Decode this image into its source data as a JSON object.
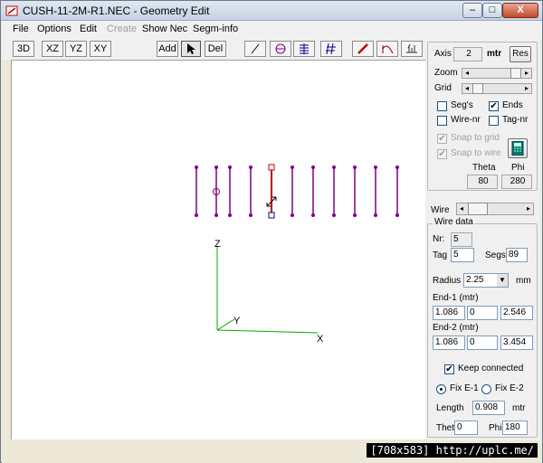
{
  "window": {
    "title": "CUSH-11-2M-R1.NEC - Geometry Edit",
    "min_label": "–",
    "max_label": "□",
    "close_label": "X"
  },
  "menu": [
    "File",
    "Options",
    "Edit",
    "Create",
    "Show Nec",
    "Segm-info"
  ],
  "toolbar": {
    "view_3d": "3D",
    "view_xz": "XZ",
    "view_yz": "YZ",
    "view_xy": "XY",
    "add": "Add",
    "del": "Del"
  },
  "canvas": {
    "axis_z": "Z",
    "axis_y": "Y",
    "axis_x": "X",
    "wire_color": "#800080",
    "selected_wire_color": "#c00000",
    "axis_color": "#00aa00"
  },
  "panel": {
    "axis_label": "Axis",
    "axis_value": "2",
    "axis_unit": "mtr",
    "res_button": "Res",
    "zoom_label": "Zoom",
    "grid_label": "Grid",
    "segs_label": "Seg's",
    "segs_checked": false,
    "ends_label": "Ends",
    "ends_checked": true,
    "wirenr_label": "Wire-nr",
    "wirenr_checked": false,
    "tagnr_label": "Tag-nr",
    "tagnr_checked": false,
    "snap_grid_label": "Snap to grid",
    "snap_grid_checked": true,
    "snap_wire_label": "Snap to wire",
    "snap_wire_checked": true,
    "theta_label": "Theta",
    "phi_label": "Phi",
    "theta_value": "80",
    "phi_value": "280",
    "wire_label": "Wire",
    "wire_data_title": "Wire data",
    "nr_label": "Nr:",
    "nr_value": "5",
    "tag_label": "Tag",
    "tag_value": "5",
    "segs_field_label": "Segs",
    "segs_value": "89",
    "radius_label": "Radius",
    "radius_value": "2.25",
    "radius_unit": "mm",
    "end1_label": "End-1 (mtr)",
    "end1_x": "1.086",
    "end1_y": "0",
    "end1_z": "2.546",
    "end2_label": "End-2 (mtr)",
    "end2_x": "1.086",
    "end2_y": "0",
    "end2_z": "3.454",
    "keep_connected_label": "Keep connected",
    "keep_connected_checked": true,
    "fix_e1_label": "Fix E-1",
    "fix_e2_label": "Fix E-2",
    "length_label": "Length",
    "length_value": "0.908",
    "length_unit": "mtr",
    "theta2_label": "Thet",
    "theta2_value": "0",
    "phi2_label": "Phi",
    "phi2_value": "180"
  },
  "watermark": "[708x583] http://uplc.me/"
}
